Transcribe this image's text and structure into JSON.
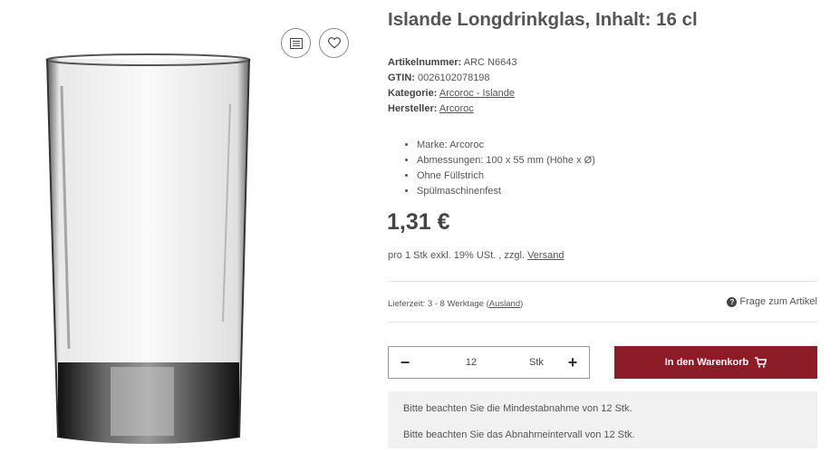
{
  "product": {
    "title": "Islande Longdrinkglas, Inhalt: 16 cl",
    "meta": [
      {
        "label": "Artikelnummer:",
        "value": "ARC N6643"
      },
      {
        "label": "GTIN:",
        "value": "0026102078198"
      },
      {
        "label": "Kategorie:",
        "value": "Arcoroc - Islande"
      },
      {
        "label": "Hersteller:",
        "value": "Arcoroc"
      }
    ],
    "features": [
      "Marke: Arcoroc",
      "Abmessungen: 100 x 55 mm (Höhe x Ø)",
      "Ohne Füllstrich",
      "Spülmaschinenfest"
    ],
    "price": "1,31 €",
    "tax_prefix": "pro 1 Stk exkl. 19% USt. , zzgl.",
    "tax_link": "Versand"
  },
  "delivery": {
    "prefix": "Lieferzeit: 3 - 8 Werktage (",
    "link": "Ausland",
    "suffix": ")"
  },
  "question_label": "Frage zum Artikel",
  "question_icon": "question-circle-icon",
  "quantity": {
    "minus": "−",
    "value": "12",
    "unit": "Stk",
    "plus": "+"
  },
  "cart": {
    "label": "In den Warenkorb",
    "icon": "shopping-cart-icon",
    "color": "#8c1c28"
  },
  "notices": [
    "Bitte beachten Sie die Mindestabnahme von 12 Stk.",
    "Bitte beachten Sie das Abnahmeintervall von 12 Stk."
  ],
  "action_icons": [
    "compare-list-icon",
    "heart-icon"
  ]
}
